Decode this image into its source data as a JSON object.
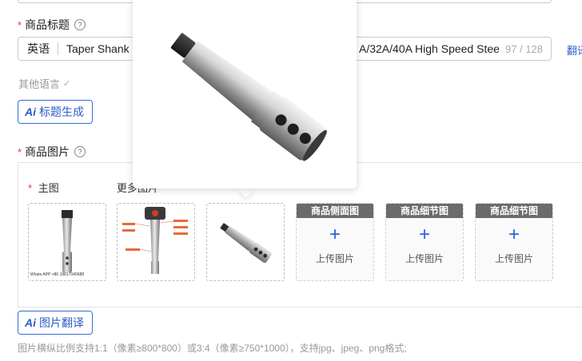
{
  "title_field": {
    "label": "商品标题",
    "help": "?",
    "lang": "英语",
    "value_start": "Taper Shank",
    "value_end": "A/32A/40A High Speed Stee",
    "counter": "97 / 128",
    "translate_link": "翻译"
  },
  "other_langs": {
    "label": "其他语言",
    "caret": "✓"
  },
  "title_gen_button": {
    "ai": "Ai",
    "label": "标题生成"
  },
  "images_field": {
    "label": "商品图片",
    "help": "?"
  },
  "main_image": {
    "label": "主图",
    "watermark": "Whats APP +86 18817040688"
  },
  "more_images": {
    "label": "更多图片"
  },
  "upload_slots": [
    {
      "header": "商品侧面图",
      "plus": "+",
      "text": "上传图片"
    },
    {
      "header": "商品细节图",
      "plus": "+",
      "text": "上传图片"
    },
    {
      "header": "商品细节图",
      "plus": "+",
      "text": "上传图片"
    }
  ],
  "image_translate_button": {
    "ai": "Ai",
    "label": "图片翻译"
  },
  "hint": "图片横纵比例支持1:1（像素≥800*800）或3:4（像素≥750*1000），支持jpg、jpeg、png格式;",
  "colors": {
    "accent": "#2c5cc9",
    "required": "#e4393c",
    "slot_header": "#6b6b6b"
  }
}
